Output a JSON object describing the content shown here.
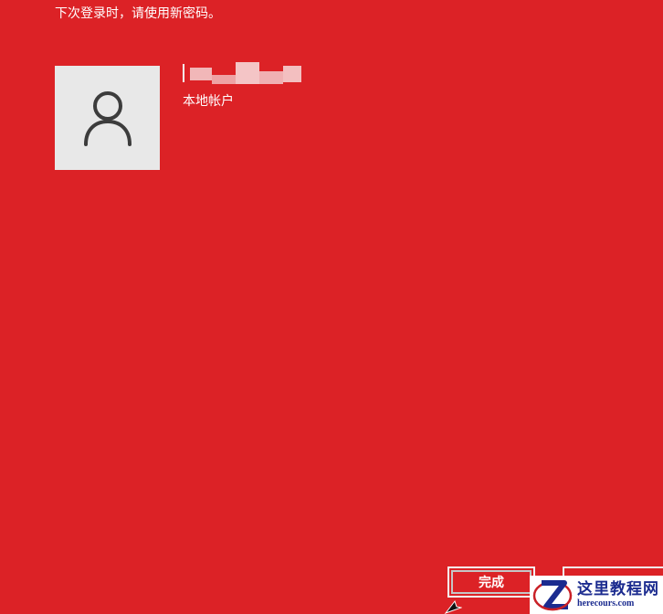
{
  "notice": {
    "text": "下次登录时，请使用新密码。"
  },
  "account": {
    "avatar_icon": "user-icon",
    "name_redacted": true,
    "type_label": "本地帐户"
  },
  "buttons": {
    "finish_label": "完成",
    "cancel_label": ""
  },
  "watermark": {
    "cn": "这里教程网",
    "en": "herecours.com"
  },
  "colors": {
    "background": "#dc2226",
    "avatar_bg": "#e8e8e8",
    "avatar_icon": "#3c3c3c",
    "text": "#ffffff",
    "watermark_text": "#1b2b8f"
  }
}
